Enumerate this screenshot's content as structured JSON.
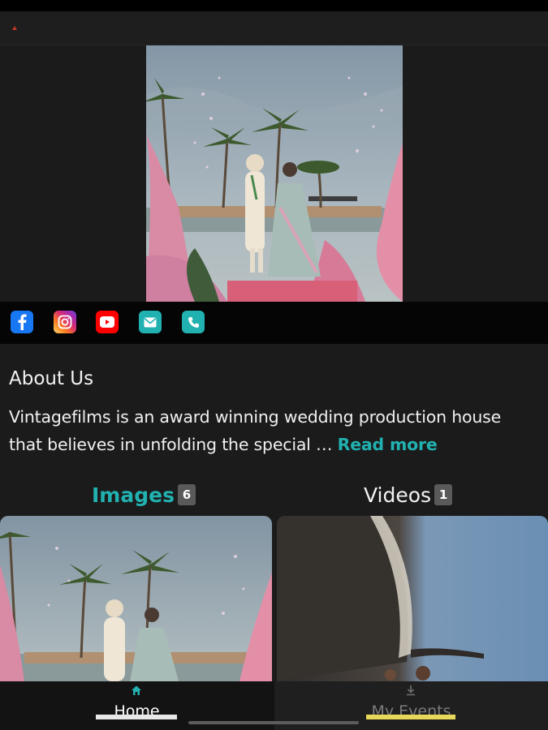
{
  "about": {
    "title": "About Us",
    "text": "Vintagefilms is an award winning wedding production house that believes in unfolding the special … ",
    "read_more": "Read more"
  },
  "social": [
    {
      "name": "facebook",
      "color": "#1877f2"
    },
    {
      "name": "instagram",
      "color": "#d6249f"
    },
    {
      "name": "youtube",
      "color": "#ff0000"
    },
    {
      "name": "email",
      "color": "#21b1b0"
    },
    {
      "name": "phone",
      "color": "#21b1b0"
    }
  ],
  "tabs": [
    {
      "label": "Images",
      "count": "6",
      "active": true
    },
    {
      "label": "Videos",
      "count": "1",
      "active": false
    }
  ],
  "bottom_nav": [
    {
      "label": "Home",
      "icon": "home-icon",
      "active": true
    },
    {
      "label": "My Events",
      "icon": "download-icon",
      "active": false
    }
  ],
  "colors": {
    "accent": "#21b1b0",
    "background": "#1b1b1b",
    "badge": "#5a5a5a"
  }
}
